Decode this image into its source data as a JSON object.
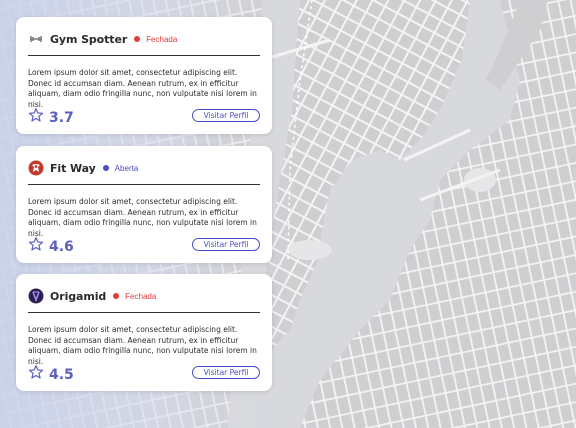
{
  "gyms": [
    {
      "name": "Gym Spotter",
      "logo_icon": "dumbbell-icon",
      "status": "Fechada",
      "status_color": "#e23b3b",
      "description": "Lorem ipsum dolor sit amet, consectetur adipiscing elit. Donec id accumsan diam. Aenean rutrum, ex in efficitur aliquam, diam odio fringilla nunc, non vulputate nisi lorem in nisi.",
      "rating": "3.7",
      "button_label": "Visitar Perfil"
    },
    {
      "name": "Fit Way",
      "logo_icon": "fitway-logo-icon",
      "status": "Aberta",
      "status_color": "#4c4dc9",
      "description": "Lorem ipsum dolor sit amet, consectetur adipiscing elit. Donec id accumsan diam. Aenean rutrum, ex in efficitur aliquam, diam odio fringilla nunc, non vulputate nisi lorem in nisi.",
      "rating": "4.6",
      "button_label": "Visitar Perfil"
    },
    {
      "name": "Origamid",
      "logo_icon": "origamid-logo-icon",
      "status": "Fechada",
      "status_color": "#e23b3b",
      "description": "Lorem ipsum dolor sit amet, consectetur adipiscing elit. Donec id accumsan diam. Aenean rutrum, ex in efficitur aliquam, diam odio fringilla nunc, non vulputate nisi lorem in nisi.",
      "rating": "4.5",
      "button_label": "Visitar Perfil"
    }
  ],
  "colors": {
    "accent": "#4c4dc9",
    "star": "#5b5fbf",
    "closed": "#e23b3b",
    "open": "#4c4dc9"
  }
}
